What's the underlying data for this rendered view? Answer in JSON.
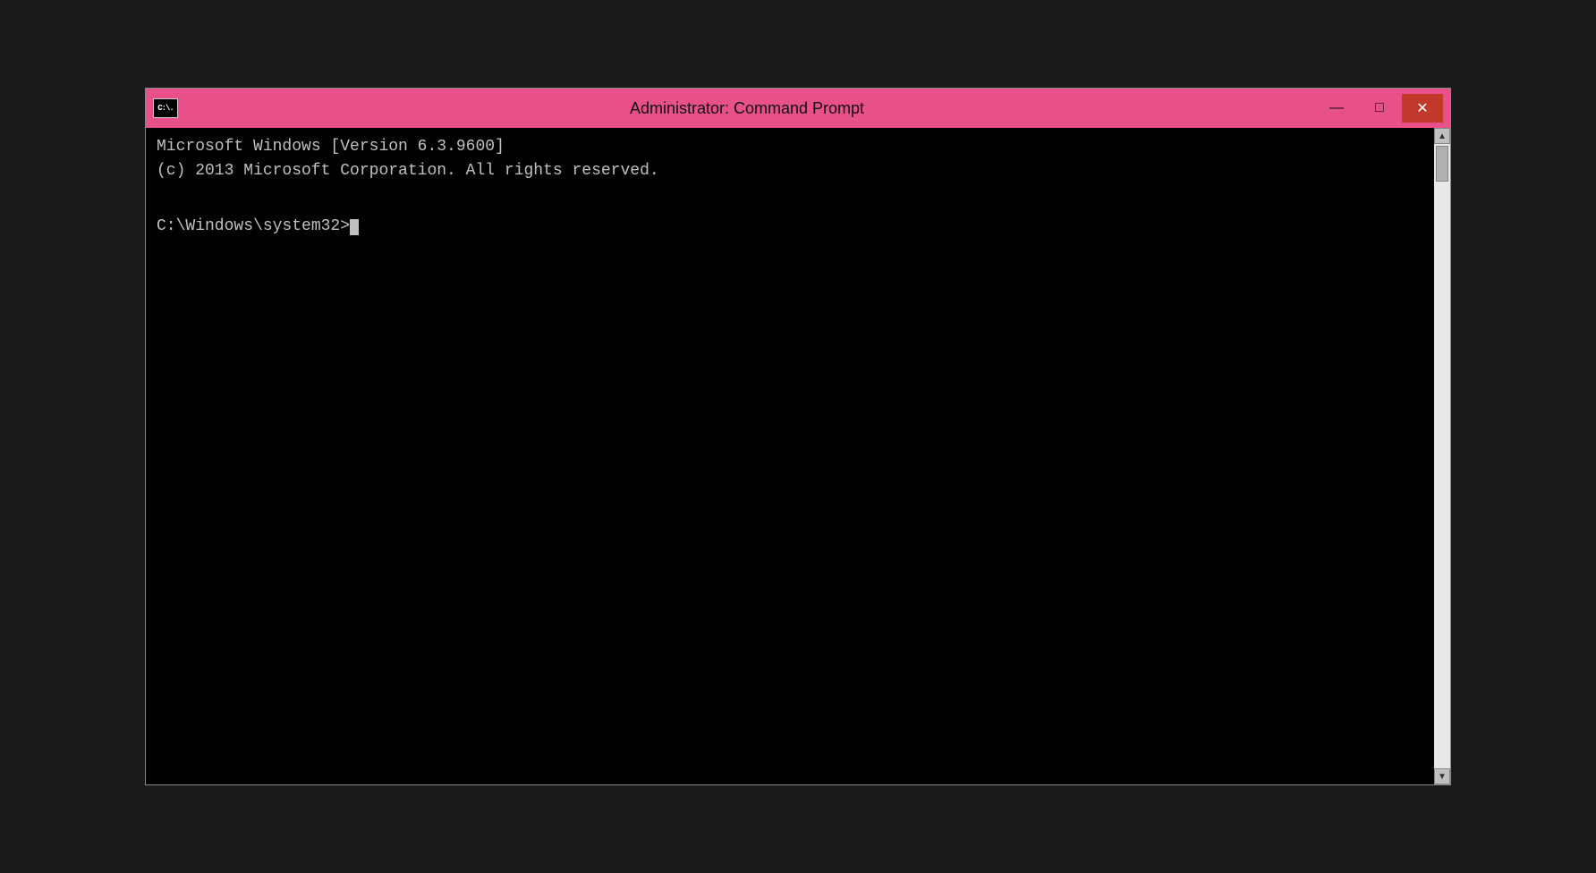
{
  "window": {
    "title": "Administrator: Command Prompt",
    "icon_label": "C:\\.",
    "controls": {
      "minimize": "—",
      "maximize": "□",
      "close": "✕"
    }
  },
  "terminal": {
    "line1": "Microsoft Windows [Version 6.3.9600]",
    "line2": "(c) 2013 Microsoft Corporation. All rights reserved.",
    "line3": "",
    "prompt": "C:\\Windows\\system32>"
  },
  "colors": {
    "titlebar_bg": "#e8508a",
    "close_btn_bg": "#c0392b",
    "terminal_bg": "#000000",
    "terminal_text": "#c0c0c0"
  }
}
